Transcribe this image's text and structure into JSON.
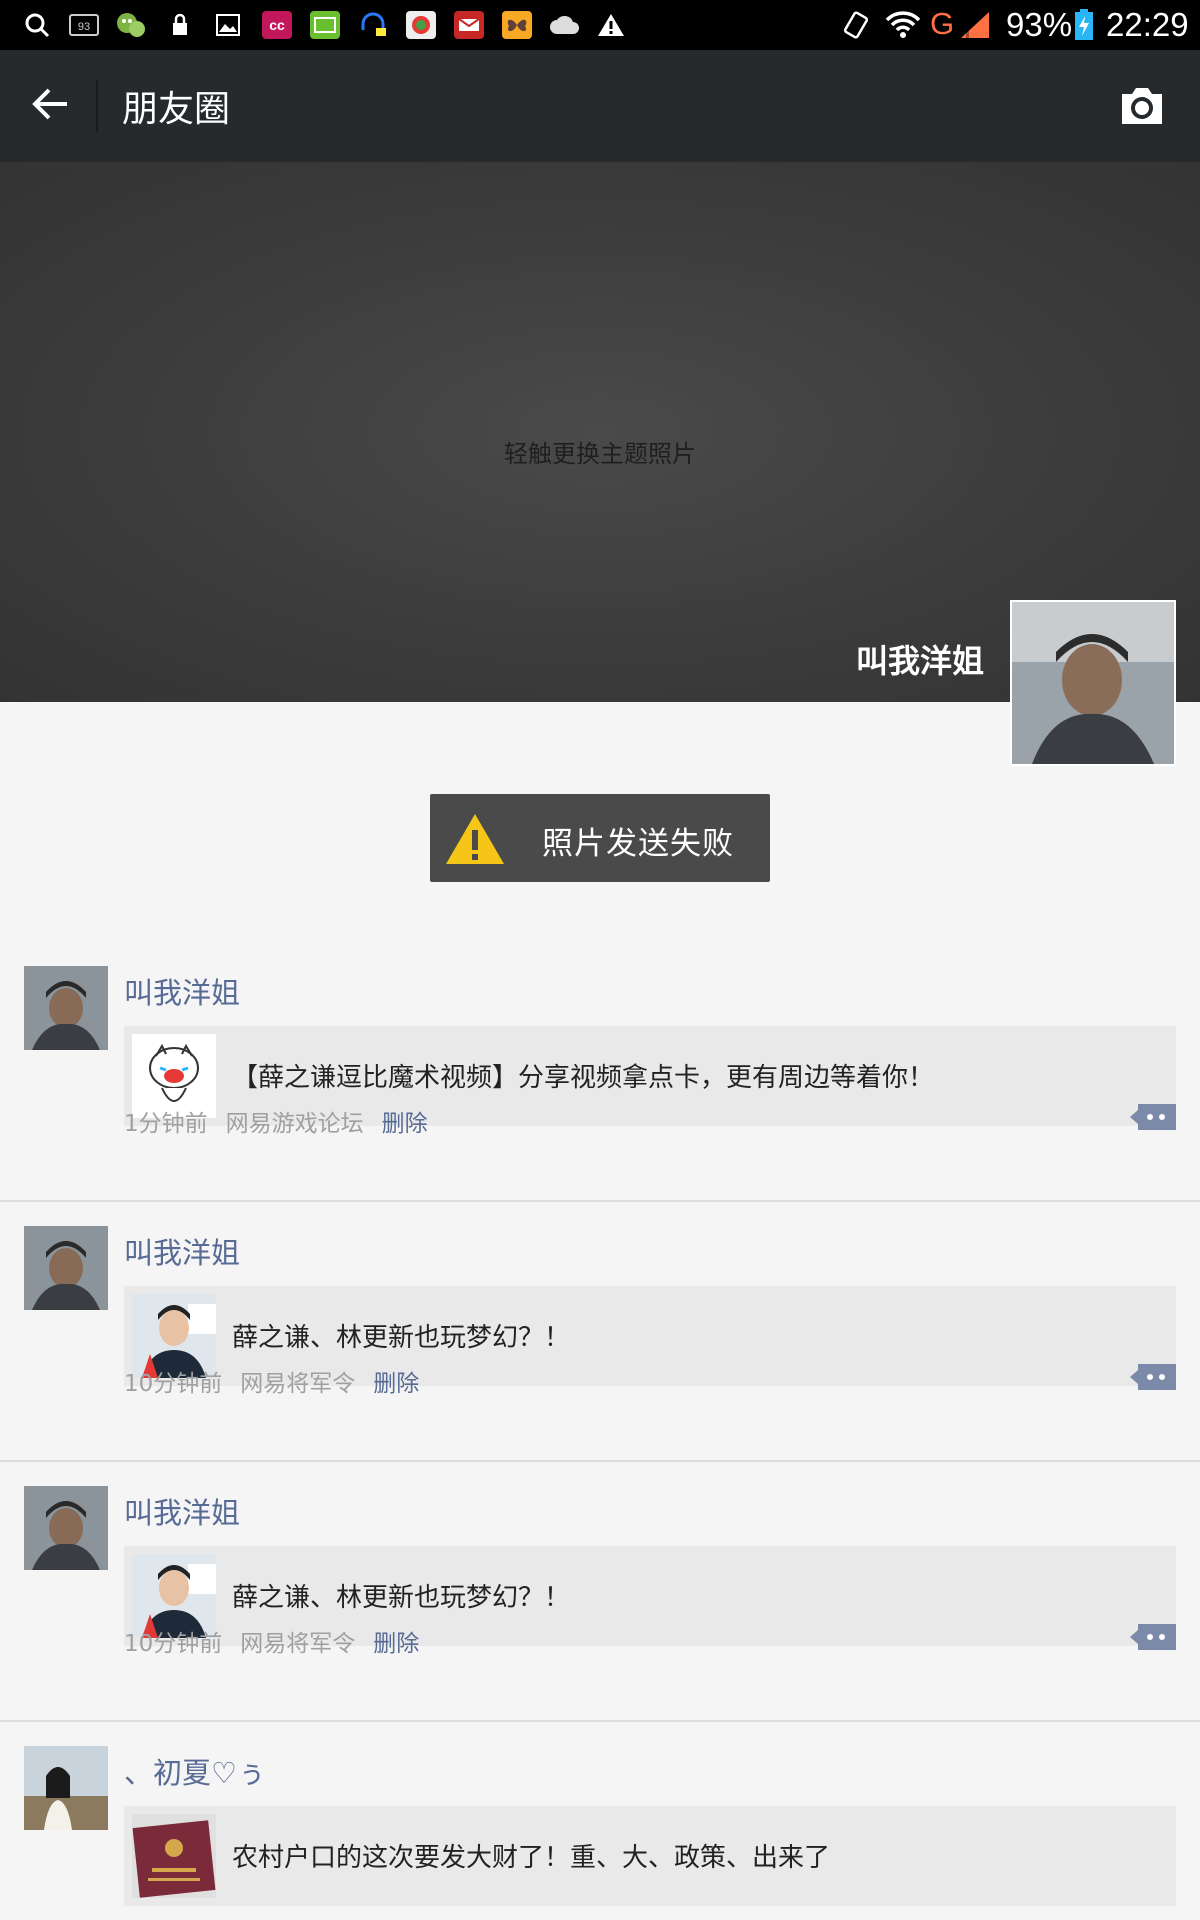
{
  "status_bar": {
    "battery": "93%",
    "time": "22:29",
    "carrier": "G",
    "icons": [
      "search-icon",
      "battery-93-icon",
      "wechat-game-icon",
      "lock-icon",
      "image-icon",
      "cc-app-icon",
      "iqiyi-icon",
      "headset-app-icon",
      "photo-app-icon",
      "mail-app-icon",
      "butterfly-app-icon",
      "cloud-icon",
      "warning-icon"
    ]
  },
  "navbar": {
    "title": "朋友圈"
  },
  "cover": {
    "hint": "轻触更换主题照片",
    "user_name": "叫我洋姐"
  },
  "toast": {
    "message": "照片发送失败"
  },
  "posts": [
    {
      "name": "叫我洋姐",
      "text": "【薛之谦逗比魔术视频】分享视频拿点卡，更有周边等着你！",
      "time": "1分钟前",
      "source": "网易游戏论坛",
      "delete": "删除"
    },
    {
      "name": "叫我洋姐",
      "text": "薛之谦、林更新也玩梦幻？！",
      "time": "10分钟前",
      "source": "网易将军令",
      "delete": "删除"
    },
    {
      "name": "叫我洋姐",
      "text": "薛之谦、林更新也玩梦幻？！",
      "time": "10分钟前",
      "source": "网易将军令",
      "delete": "删除"
    },
    {
      "name": "、初夏♡ぅ",
      "text": "农村户口的这次要发大财了！重、大、政策、出来了"
    }
  ],
  "colors": {
    "nav_bg": "#262a2d",
    "link": "#576b95",
    "toast_bg": "#4a4a4a",
    "warning": "#f5c518"
  }
}
